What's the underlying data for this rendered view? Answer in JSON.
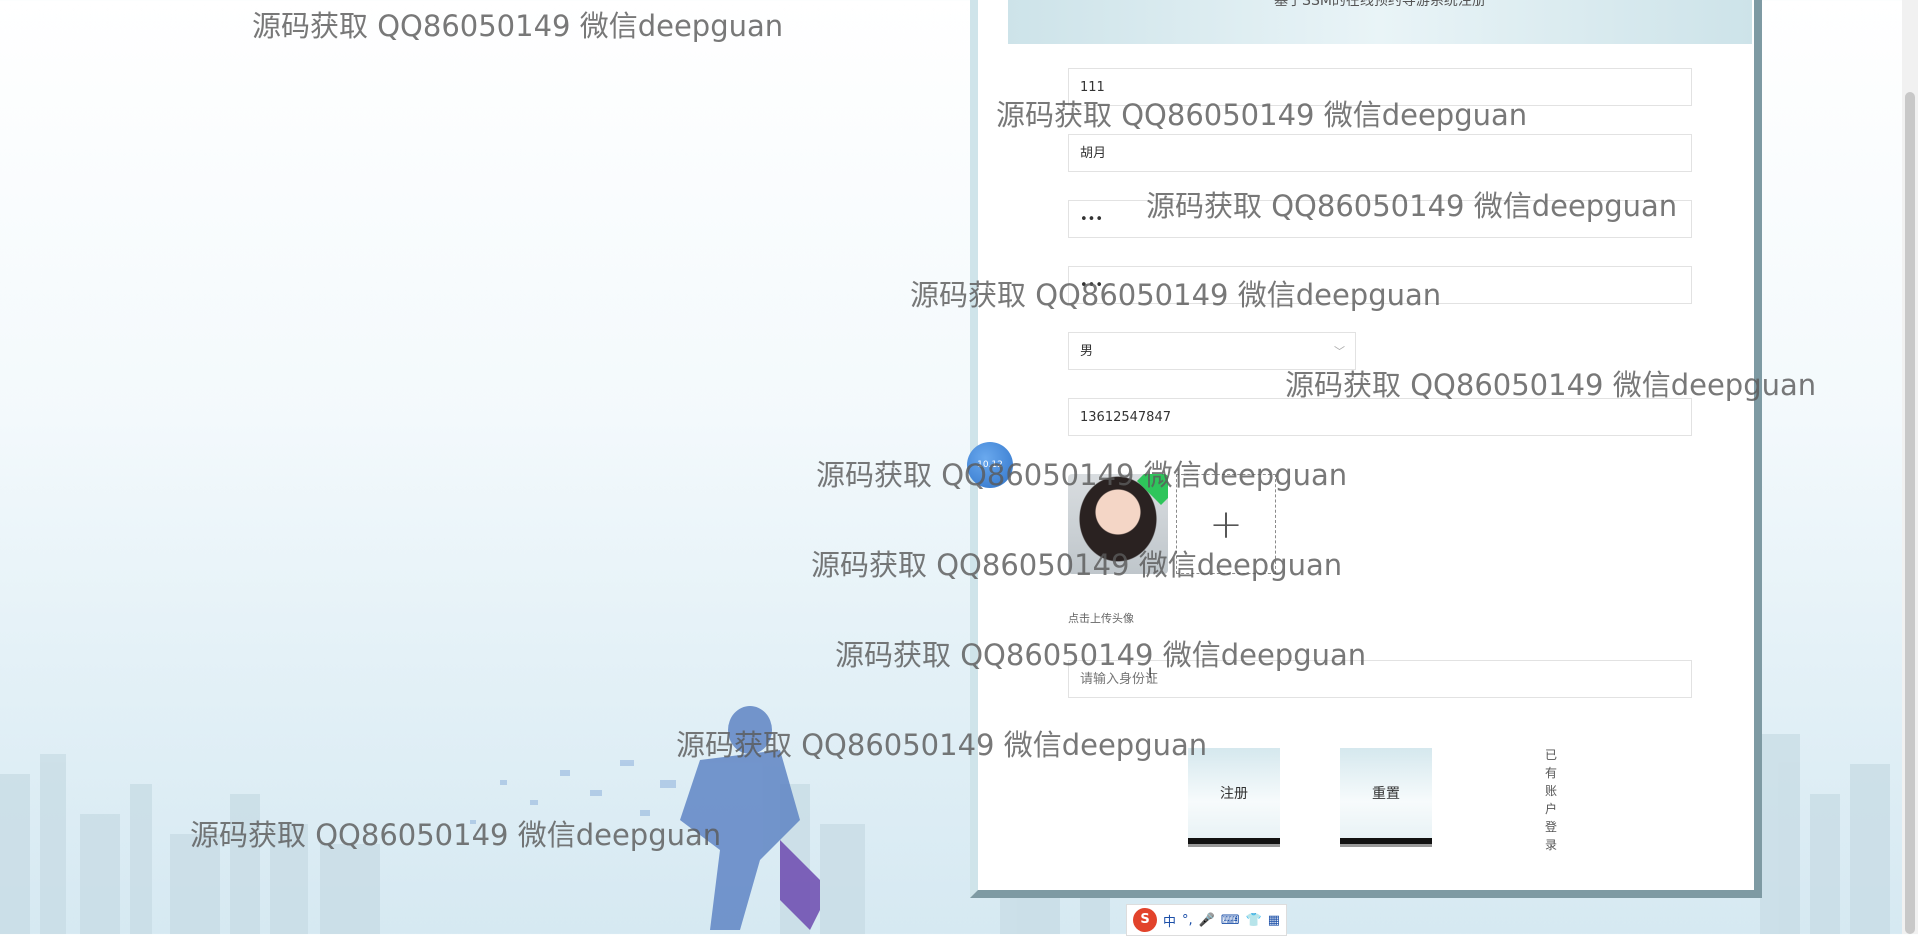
{
  "form": {
    "header_title": "基于SSM的在线预约导游系统注册",
    "fields": {
      "account": "111",
      "name": "胡月",
      "password": "•••",
      "confirm_password": "•••",
      "gender": "男",
      "phone": "13612547847",
      "id_card_placeholder": "请输入身份证"
    },
    "upload_hint": "点击上传头像",
    "upload_plus": "+",
    "register_button": "注册",
    "reset_button": "重置",
    "login_link": "已有账户登录"
  },
  "float_ball_text": "10.12",
  "watermark_text": "源码获取 QQ86050149 微信deepguan",
  "ime_toolbar": {
    "logo": "S",
    "mode": "中",
    "punct": "°,",
    "mic": "🎤",
    "keyboard": "⌨",
    "skin": "👕",
    "tools": "▦"
  },
  "colors": {
    "panel_border": "#cfe4ea",
    "panel_shadow": "#7e9aa3",
    "button_bg": "#d5e8ee",
    "avatar_badge": "#2ec55b"
  }
}
